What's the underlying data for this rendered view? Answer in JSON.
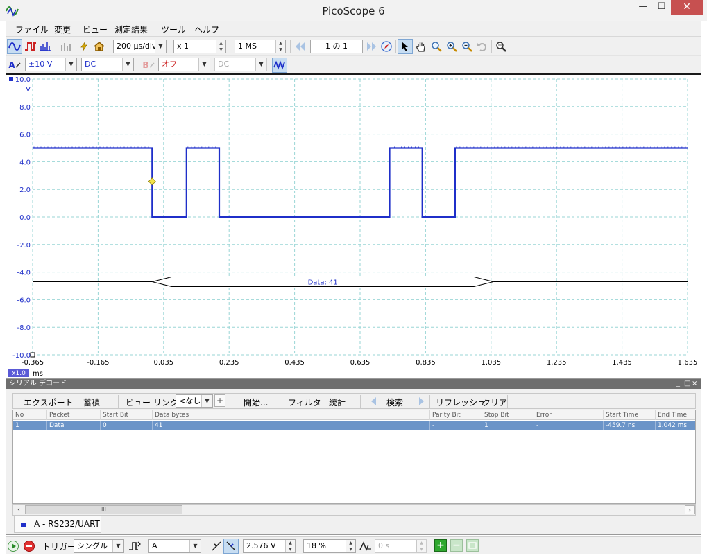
{
  "window": {
    "title": "PicoScope 6",
    "minimize_glyph": "—",
    "maximize_glyph": "☐",
    "close_glyph": "✕",
    "icon": "picoscope-logo-icon"
  },
  "menu": {
    "items": [
      "ファイル",
      "変更",
      "ビュー",
      "測定結果",
      "ツール",
      "ヘルプ"
    ]
  },
  "toolbar_top": {
    "timebase": "200 µs/div",
    "zoom": "x 1",
    "samples": "1 MS",
    "buffer": "1 の 1",
    "icons": [
      "scope-mode-icon",
      "persistence-mode-icon",
      "spectrum-mode-icon",
      "signal-generator-icon",
      "autosetup-icon",
      "home-icon",
      "first-buffer-icon",
      "last-buffer-icon",
      "pointer-icon",
      "hand-icon",
      "zoom-icon",
      "zoom-in-icon",
      "zoom-out-icon",
      "undo-zoom-icon",
      "zoom-overview-icon"
    ]
  },
  "toolbar_channels": {
    "channel_a_label": "A",
    "channel_a_range": "±10 V",
    "channel_a_coupling": "DC",
    "channel_b_label": "B",
    "channel_b_range": "オフ",
    "channel_b_coupling": "DC"
  },
  "scope": {
    "y_unit": "V",
    "x_unit": "ms",
    "x_scale": "x1.0",
    "y_ticks": [
      "10.0",
      "8.0",
      "6.0",
      "4.0",
      "2.0",
      "0.0",
      "-2.0",
      "-4.0",
      "-6.0",
      "-8.0",
      "-10.0"
    ],
    "x_ticks": [
      "-0.365",
      "-0.165",
      "0.035",
      "0.235",
      "0.435",
      "0.635",
      "0.835",
      "1.035",
      "1.235",
      "1.435",
      "1.635"
    ],
    "decode_label": "Data: 41",
    "trace_color": "#1f2fc9",
    "grid_color": "#9ad6d6"
  },
  "chart_data": {
    "type": "line",
    "xlabel": "ms",
    "ylabel": "V",
    "xlim": [
      -0.365,
      1.635
    ],
    "ylim": [
      -10,
      10
    ],
    "series": [
      {
        "x": [
          -0.365,
          0.0,
          0.0,
          0.105,
          0.105,
          0.205,
          0.205,
          0.725,
          0.725,
          0.825,
          0.825,
          0.925,
          0.925,
          1.635
        ],
        "y": [
          5.0,
          5.0,
          0.0,
          0.0,
          5.0,
          5.0,
          0.0,
          0.0,
          5.0,
          5.0,
          0.0,
          0.0,
          5.0,
          5.0
        ]
      }
    ],
    "trigger": {
      "x": 0.0,
      "y": 2.576
    },
    "decode_bus": {
      "label": "Data: 41",
      "y": -4.7,
      "start": 0.0,
      "end": 1.042
    }
  },
  "decode_panel": {
    "title": "シリアル デコード",
    "title_controls": [
      "_",
      "□",
      "×"
    ],
    "toolbar": [
      "エクスポート",
      "蓄積",
      "ビュー リンク:",
      "<なし>",
      "開始...",
      "フィルタ",
      "統計",
      "検索",
      "リフレッシュ",
      "クリア"
    ],
    "columns": [
      "No",
      "Packet",
      "Start Bit",
      "Data bytes",
      "Parity Bit",
      "Stop Bit",
      "Error",
      "Start Time",
      "End Time"
    ],
    "rows": [
      [
        "1",
        "Data",
        "0",
        "41",
        "-",
        "1",
        "-",
        "-459.7 ns",
        "1.042 ms"
      ]
    ],
    "scroll_thumb": "III",
    "tab_label": "A - RS232/UART"
  },
  "toolbar_bottom": {
    "trigger_label": "トリガー",
    "trigger_mode": "シングル",
    "trigger_source": "A",
    "trigger_level": "2.576 V",
    "pretrigger": "18 %",
    "delay": "0 s"
  }
}
